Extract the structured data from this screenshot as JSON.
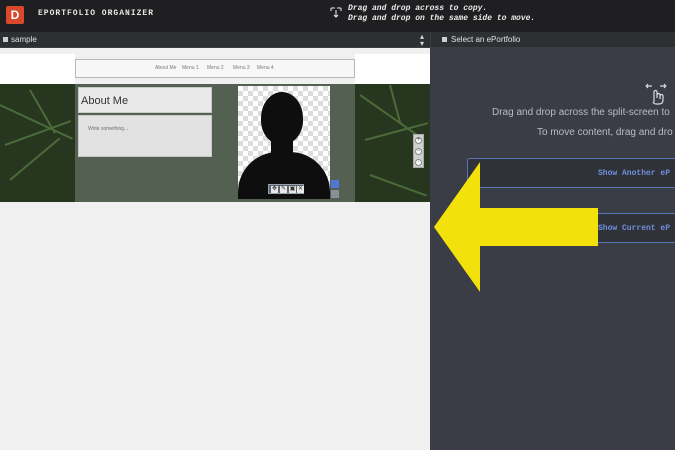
{
  "app": {
    "logo_letter": "D",
    "title": "EPORTFOLIO ORGANIZER",
    "hint_line1": "Drag and drop across to copy.",
    "hint_line2": "Drag and drop on the same side to move."
  },
  "left_panel": {
    "selector_value": "sample",
    "page": {
      "nav": [
        "About Me",
        "Menu 1",
        "Menu 2",
        "Menu 3",
        "Menu 4"
      ],
      "section_title": "About Me",
      "text_placeholder": "Write something..."
    }
  },
  "right_panel": {
    "selector_label": "Select an ePortfolio",
    "instruction_line1": "Drag and drop across the split-screen to",
    "instruction_line2": "To move content, drag and dro",
    "buttons": {
      "show_another": "Show Another eP",
      "show_current": "Show Current eP"
    }
  },
  "colors": {
    "logo_bg": "#d9492e",
    "button_border": "#5a75b5",
    "button_text": "#6f8fdc",
    "arrow": "#f2e10a",
    "topbar_bg": "#1f1f21",
    "right_bg": "#3a3d45"
  },
  "icons": {
    "hint": "drag-drop-icon",
    "gesture": "touch-gesture-icon"
  }
}
